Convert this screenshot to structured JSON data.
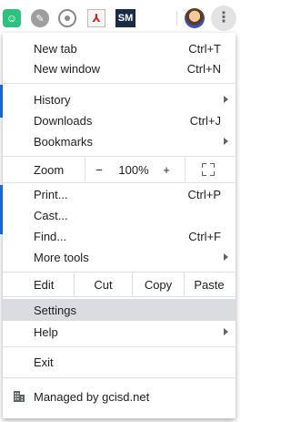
{
  "toolbar": {
    "extensions": [
      {
        "icon": "emoji-extension-icon",
        "glyph": "☺"
      },
      {
        "icon": "pencil-extension-icon",
        "glyph": "✎"
      },
      {
        "icon": "chrome-extension-icon",
        "glyph": ""
      },
      {
        "icon": "pdf-extension-icon",
        "glyph": "⅄"
      },
      {
        "icon": "sm-extension-icon",
        "glyph": "SM"
      },
      {
        "icon": "four-dots-extension-icon",
        "glyph": ""
      }
    ],
    "menu_glyph": "⋮"
  },
  "colors": {
    "dot_red": "#ea4335",
    "dot_orange": "#f29900",
    "dot_green": "#34a853",
    "dot_blue": "#1a73e8"
  },
  "menu": {
    "new_tab": {
      "label": "New tab",
      "shortcut": "Ctrl+T"
    },
    "new_window": {
      "label": "New window",
      "shortcut": "Ctrl+N"
    },
    "history": {
      "label": "History"
    },
    "downloads": {
      "label": "Downloads",
      "shortcut": "Ctrl+J"
    },
    "bookmarks": {
      "label": "Bookmarks"
    },
    "zoom": {
      "label": "Zoom",
      "minus": "−",
      "level": "100%",
      "plus": "+"
    },
    "print": {
      "label": "Print...",
      "shortcut": "Ctrl+P"
    },
    "cast": {
      "label": "Cast..."
    },
    "find": {
      "label": "Find...",
      "shortcut": "Ctrl+F"
    },
    "more_tools": {
      "label": "More tools"
    },
    "edit": {
      "label": "Edit",
      "cut": "Cut",
      "copy": "Copy",
      "paste": "Paste"
    },
    "settings": {
      "label": "Settings"
    },
    "help": {
      "label": "Help"
    },
    "exit": {
      "label": "Exit"
    },
    "managed": {
      "label": "Managed by gcisd.net"
    }
  }
}
